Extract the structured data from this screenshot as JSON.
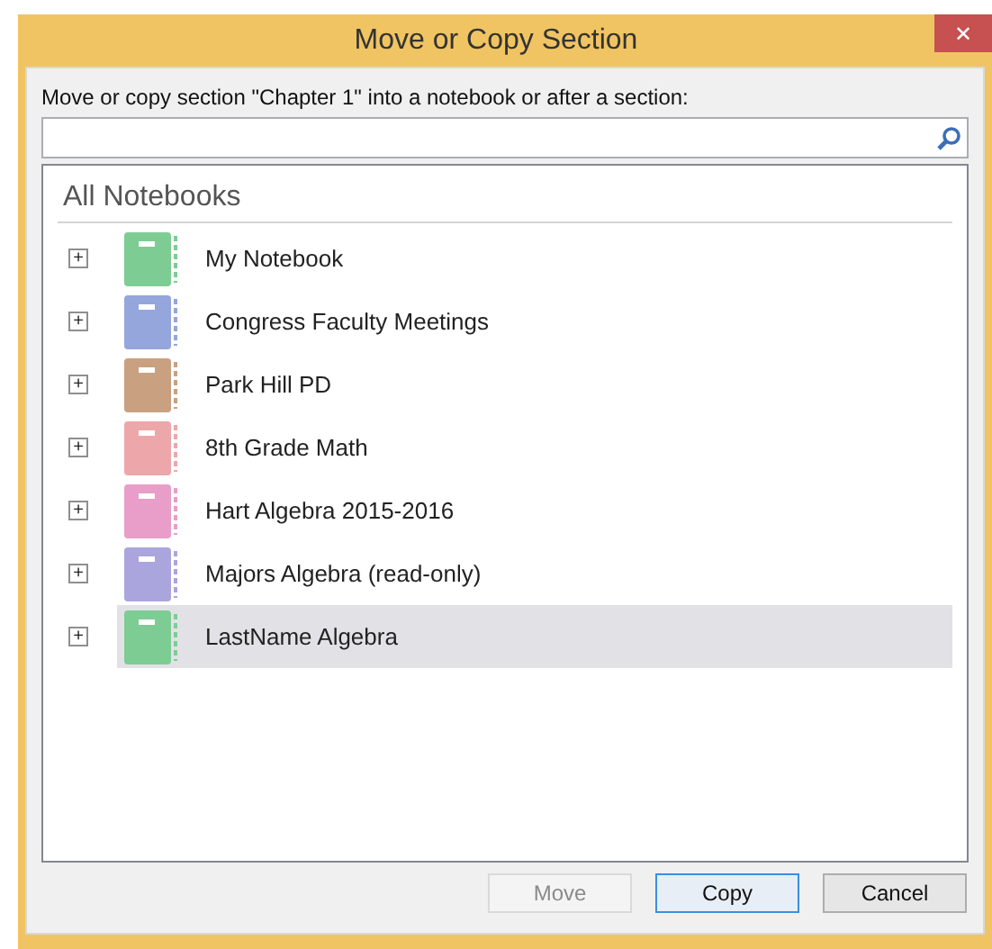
{
  "window": {
    "title": "Move or Copy Section",
    "close": "✕"
  },
  "prompt": "Move or copy section \"Chapter 1\" into a notebook or after a section:",
  "list": {
    "heading": "All Notebooks",
    "items": [
      {
        "name": "My Notebook",
        "color": "#7dcc93",
        "selected": false,
        "expander": "+"
      },
      {
        "name": "Congress Faculty Meetings",
        "color": "#94a6dc",
        "selected": false,
        "expander": "+"
      },
      {
        "name": "Park Hill PD",
        "color": "#c9a080",
        "selected": false,
        "expander": "+"
      },
      {
        "name": "8th Grade Math",
        "color": "#eda7aa",
        "selected": false,
        "expander": "+"
      },
      {
        "name": "Hart Algebra 2015-2016",
        "color": "#e89ec8",
        "selected": false,
        "expander": "+"
      },
      {
        "name": "Majors Algebra (read-only)",
        "color": "#aaa5dc",
        "selected": false,
        "expander": "+"
      },
      {
        "name": "LastName Algebra",
        "color": "#7dcc93",
        "selected": true,
        "expander": "+"
      }
    ]
  },
  "buttons": [
    {
      "label": "Move",
      "disabled": true,
      "default": false
    },
    {
      "label": "Copy",
      "disabled": false,
      "default": true
    },
    {
      "label": "Cancel",
      "disabled": false,
      "default": false
    }
  ]
}
